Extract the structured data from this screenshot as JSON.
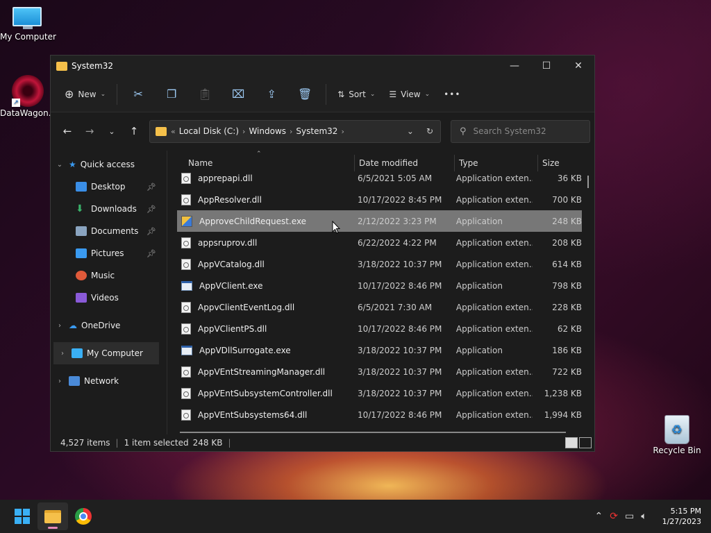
{
  "desktop": {
    "icons": [
      {
        "label": "My Computer"
      },
      {
        "label": "DataWagon..."
      },
      {
        "label": "Recycle Bin"
      }
    ]
  },
  "window": {
    "title": "System32",
    "controls": {
      "minimize": "—",
      "maximize": "☐",
      "close": "✕"
    }
  },
  "toolbar": {
    "new_label": "New",
    "sort_label": "Sort",
    "view_label": "View",
    "more_label": "•••"
  },
  "address": {
    "overflow": "«",
    "crumbs": [
      "Local Disk (C:)",
      "Windows",
      "System32"
    ],
    "search_placeholder": "Search System32"
  },
  "navpane": {
    "quick_access": "Quick access",
    "quick_items": [
      {
        "label": "Desktop",
        "color": "#3a8ee6"
      },
      {
        "label": "Downloads",
        "color": "#3ab26a"
      },
      {
        "label": "Documents",
        "color": "#8aa4c0"
      },
      {
        "label": "Pictures",
        "color": "#3a9af0"
      },
      {
        "label": "Music",
        "color": "#e05a3a"
      },
      {
        "label": "Videos",
        "color": "#8a5ad8"
      }
    ],
    "onedrive": "OneDrive",
    "my_computer": "My Computer",
    "network": "Network"
  },
  "columns": {
    "name": "Name",
    "date": "Date modified",
    "type": "Type",
    "size": "Size"
  },
  "files": [
    {
      "name": "apprepapi.dll",
      "date": "6/5/2021 5:05 AM",
      "type": "Application exten...",
      "size": "36 KB",
      "icon": "dll"
    },
    {
      "name": "AppResolver.dll",
      "date": "10/17/2022 8:45 PM",
      "type": "Application exten...",
      "size": "700 KB",
      "icon": "dll"
    },
    {
      "name": "ApproveChildRequest.exe",
      "date": "2/12/2022 3:23 PM",
      "type": "Application",
      "size": "248 KB",
      "icon": "exe-special",
      "selected": true
    },
    {
      "name": "appsruprov.dll",
      "date": "6/22/2022 4:22 PM",
      "type": "Application exten...",
      "size": "208 KB",
      "icon": "dll"
    },
    {
      "name": "AppVCatalog.dll",
      "date": "3/18/2022 10:37 PM",
      "type": "Application exten...",
      "size": "614 KB",
      "icon": "dll"
    },
    {
      "name": "AppVClient.exe",
      "date": "10/17/2022 8:46 PM",
      "type": "Application",
      "size": "798 KB",
      "icon": "exe"
    },
    {
      "name": "AppvClientEventLog.dll",
      "date": "6/5/2021 7:30 AM",
      "type": "Application exten...",
      "size": "228 KB",
      "icon": "dll"
    },
    {
      "name": "AppVClientPS.dll",
      "date": "10/17/2022 8:46 PM",
      "type": "Application exten...",
      "size": "62 KB",
      "icon": "dll"
    },
    {
      "name": "AppVDllSurrogate.exe",
      "date": "3/18/2022 10:37 PM",
      "type": "Application",
      "size": "186 KB",
      "icon": "exe"
    },
    {
      "name": "AppVEntStreamingManager.dll",
      "date": "3/18/2022 10:37 PM",
      "type": "Application exten...",
      "size": "722 KB",
      "icon": "dll"
    },
    {
      "name": "AppVEntSubsystemController.dll",
      "date": "3/18/2022 10:37 PM",
      "type": "Application exten...",
      "size": "1,238 KB",
      "icon": "dll"
    },
    {
      "name": "AppVEntSubsystems64.dll",
      "date": "10/17/2022 8:46 PM",
      "type": "Application exten...",
      "size": "1,994 KB",
      "icon": "dll"
    }
  ],
  "status": {
    "items": "4,527 items",
    "selected": "1 item selected",
    "size": "248 KB"
  },
  "taskbar": {
    "time": "5:15 PM",
    "date": "1/27/2023"
  }
}
